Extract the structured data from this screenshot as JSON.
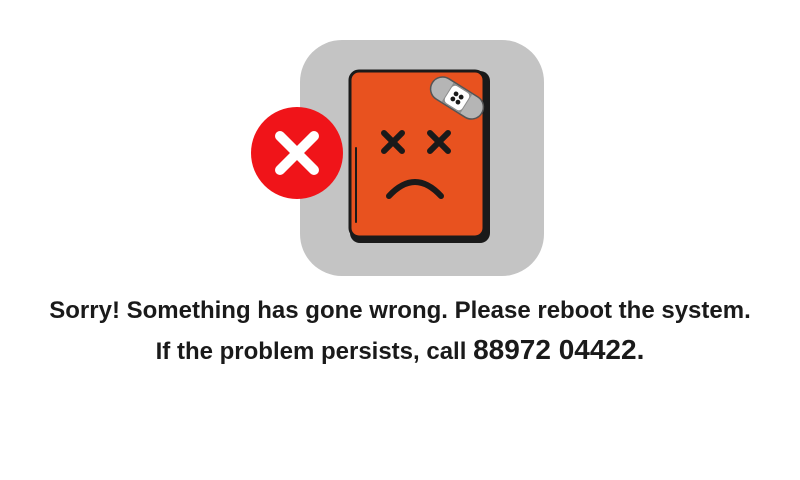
{
  "error_screen": {
    "message_line1": "Sorry! Something has gone wrong. Please reboot the system.",
    "message_line2_prefix": "If the problem persists, call ",
    "phone_number": "88972 04422",
    "message_line2_suffix": "."
  },
  "icons": {
    "device": "broken-device-icon",
    "error": "error-x-icon",
    "bandage": "bandage-icon"
  },
  "colors": {
    "background": "#ffffff",
    "icon_backdrop": "#c4c4c4",
    "device_body": "#e8521f",
    "error_badge": "#f01419",
    "text": "#1a1a1a"
  }
}
